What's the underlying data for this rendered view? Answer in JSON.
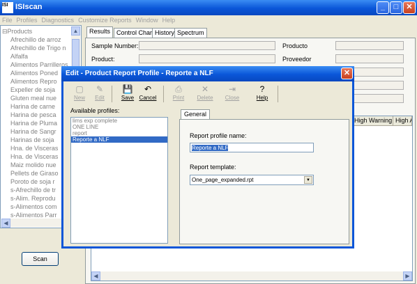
{
  "app": {
    "title": "ISIscan",
    "icon_text": "ISI"
  },
  "window_buttons": {
    "minimize": "_",
    "maximize": "□",
    "close": "✕"
  },
  "menu": [
    "File",
    "Profiles",
    "Diagnostics",
    "Customize Reports",
    "Window",
    "Help"
  ],
  "tree": {
    "root": "Products",
    "root_toggle": "⊟",
    "items": [
      "Afrechillo de arroz",
      "Afrechillo de Trigo n",
      "Alfalfa",
      "Alimentos Parrilleros",
      "Alimentos Poned",
      "Alimentos Repro",
      "Expeller de soja",
      "Gluten meal nue",
      "Harina de carne",
      "Harina de pesca",
      "Harina de Pluma",
      "Harina de Sangr",
      "Harinas de soja",
      "Hna. de Visceras",
      "Hna. de Visceras",
      "Maiz molido nue",
      "Pellets de Giraso",
      "Poroto de soja r",
      "s-Afrechillo de tr",
      "s-Alim. Reprodu",
      "s-Alimentos com",
      "s-Alimentos Parr"
    ]
  },
  "scrollbar_glyphs": {
    "up": "▲",
    "down": "▼",
    "left": "◀",
    "right": "▶"
  },
  "scan_button": "Scan",
  "main_tabs": [
    "Results",
    "Control Charts",
    "History",
    "Spectrum"
  ],
  "fields": {
    "sample_number": "Sample Number:",
    "product": "Product:",
    "producto": "Producto",
    "proveedor": "Proveedor"
  },
  "grid_headers": [
    "High Warning",
    "High A"
  ],
  "dialog": {
    "title": "Edit - Product Report Profile - Reporte a NLF",
    "close": "✕",
    "toolbar": [
      {
        "label": "New",
        "icon": "▢",
        "enabled": false
      },
      {
        "label": "Edit",
        "icon": "✎",
        "enabled": false
      },
      {
        "label": "Save",
        "icon": "💾",
        "enabled": true
      },
      {
        "label": "Cancel",
        "icon": "↶",
        "enabled": true
      },
      {
        "label": "Print",
        "icon": "⎙",
        "enabled": false
      },
      {
        "label": "Delete",
        "icon": "✕",
        "enabled": false
      },
      {
        "label": "Close",
        "icon": "⇥",
        "enabled": false
      },
      {
        "label": "Help",
        "icon": "?",
        "enabled": true
      }
    ],
    "available_profiles_label": "Available profiles:",
    "profiles": [
      "lims exp complete",
      "ONE LINE",
      "report",
      "Reporte a NLF"
    ],
    "selected_profile": "Reporte a NLF",
    "general_tab": "General",
    "report_profile_name_label": "Report profile name:",
    "report_profile_name_value": "Reporte a NLF",
    "report_template_label": "Report template:",
    "report_template_value": "One_page_expanded.rpt",
    "dropdown_arrow": "▼"
  }
}
